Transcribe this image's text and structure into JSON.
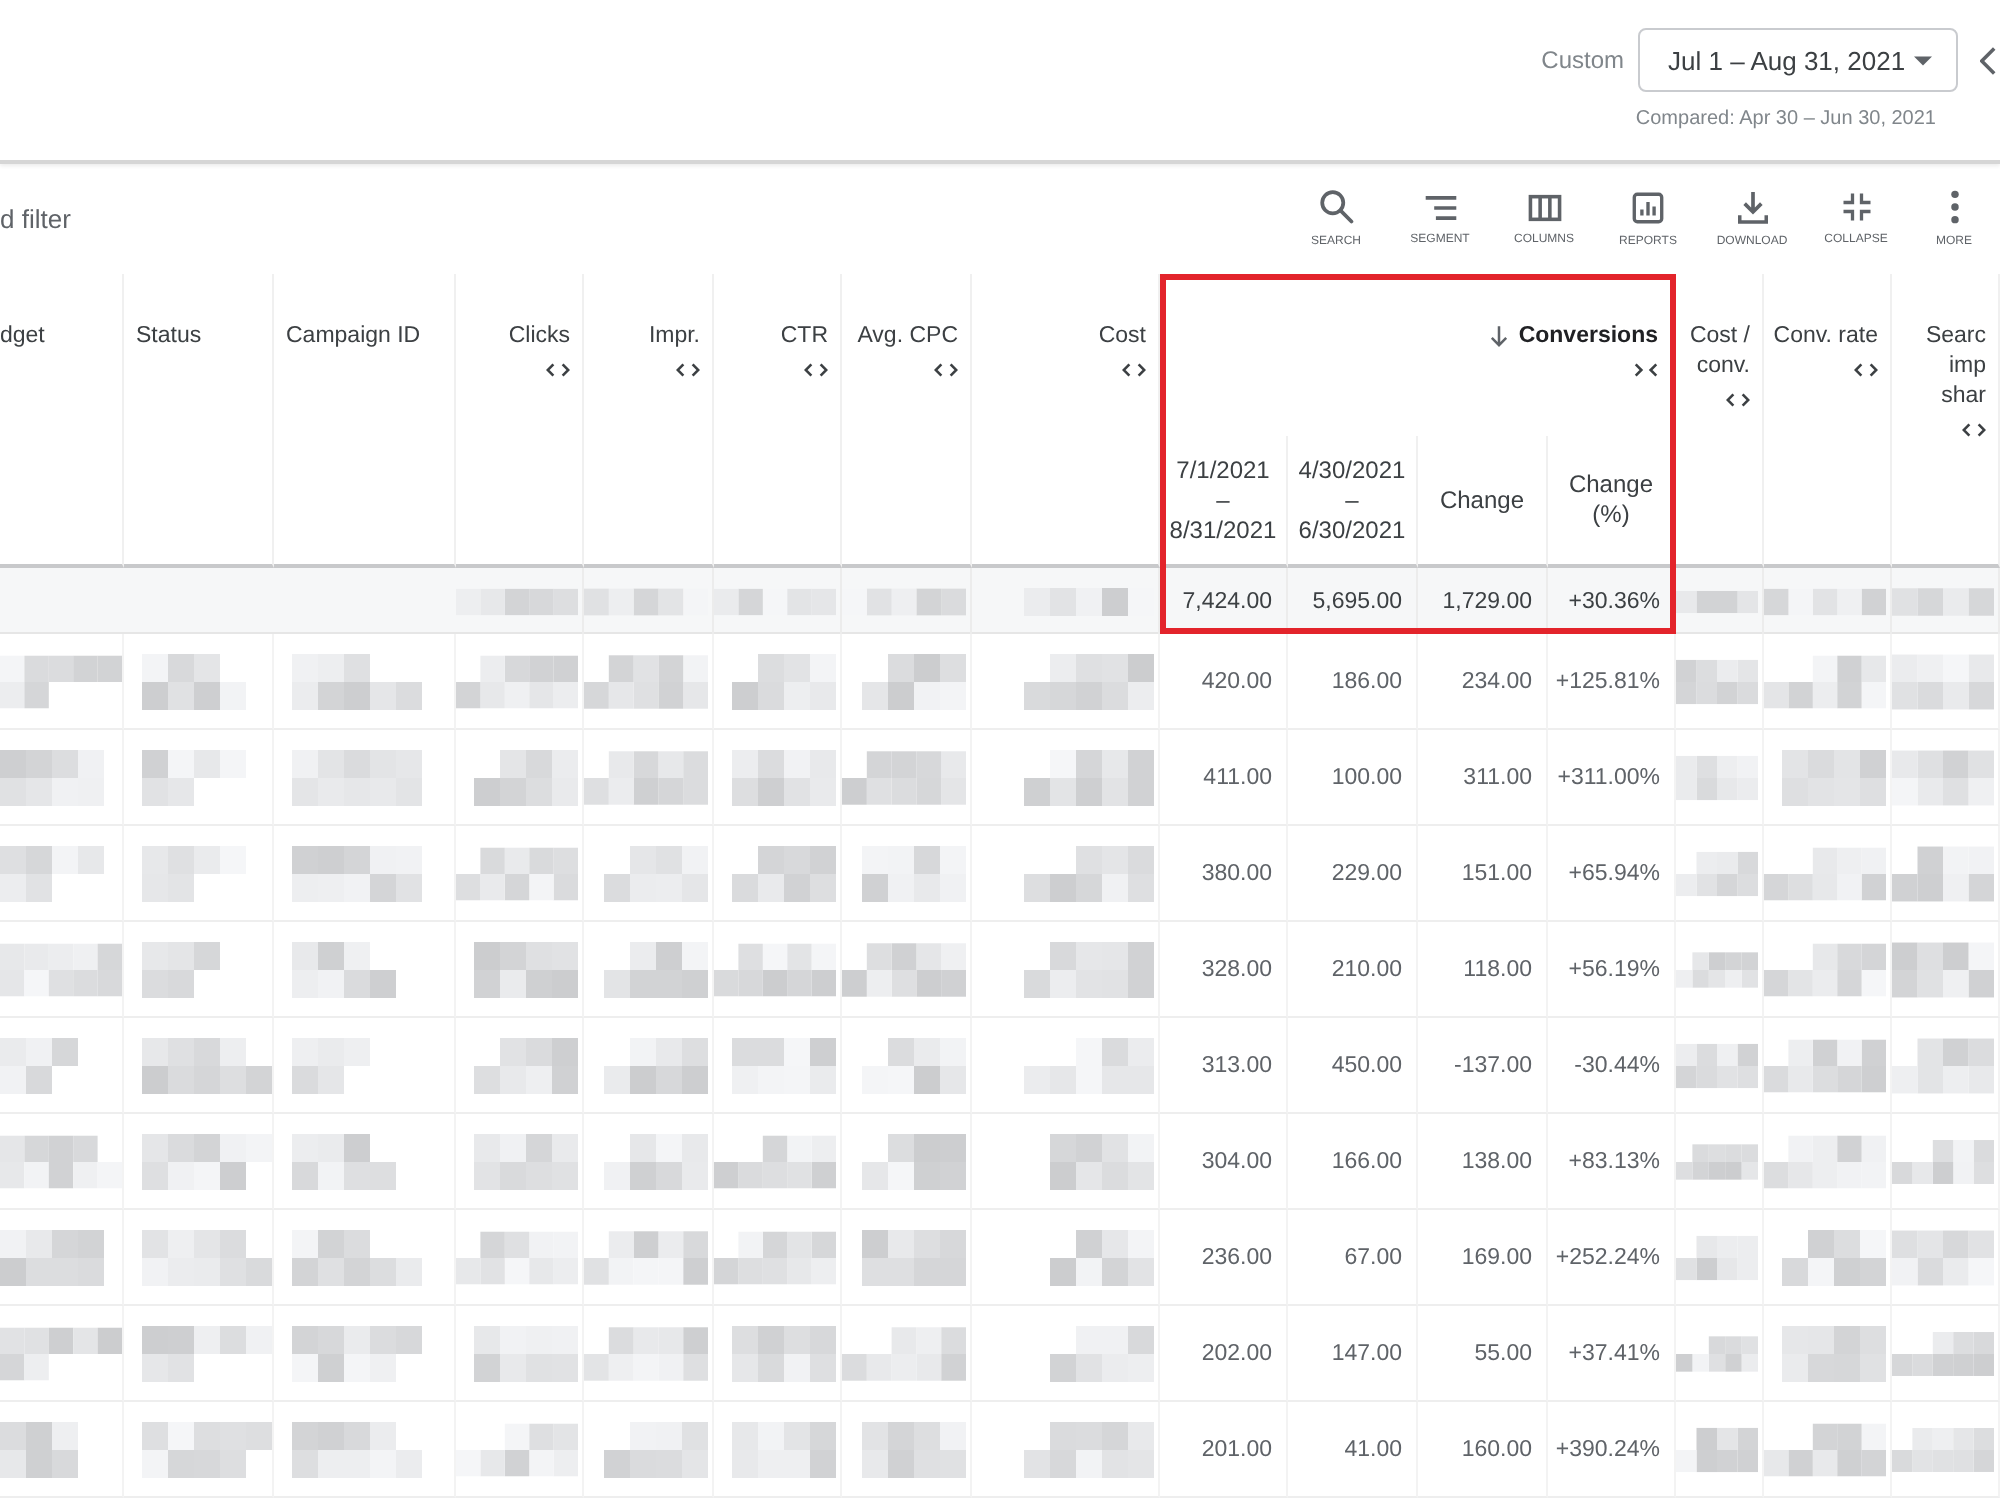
{
  "date_range": {
    "preset": "Custom",
    "value": "Jul 1 – Aug 31, 2021",
    "comparison": "Compared: Apr 30 – Jun 30, 2021"
  },
  "toolbar": {
    "filter": "d filter",
    "buttons": [
      "SEARCH",
      "SEGMENT",
      "COLUMNS",
      "REPORTS",
      "DOWNLOAD",
      "COLLAPSE",
      "MORE"
    ]
  },
  "table": {
    "columns": [
      {
        "label": "dget",
        "kind": "text",
        "redacted": true,
        "highlighted": false
      },
      {
        "label": "Status",
        "kind": "text",
        "redacted": true,
        "highlighted": false
      },
      {
        "label": "Campaign ID",
        "kind": "text",
        "redacted": true,
        "highlighted": false
      },
      {
        "label": "Clicks",
        "kind": "metric",
        "sorted": false,
        "expanded": false,
        "redacted": true,
        "highlighted": false
      },
      {
        "label": "Impr.",
        "kind": "metric",
        "sorted": false,
        "expanded": false,
        "redacted": true,
        "highlighted": false
      },
      {
        "label": "CTR",
        "kind": "metric",
        "sorted": false,
        "expanded": false,
        "redacted": true,
        "highlighted": false
      },
      {
        "label": "Avg. CPC",
        "kind": "metric",
        "sorted": false,
        "expanded": false,
        "redacted": true,
        "highlighted": false
      },
      {
        "label": "Cost",
        "kind": "metric",
        "sorted": false,
        "expanded": false,
        "redacted": true,
        "highlighted": false
      },
      {
        "label": "Conversions",
        "kind": "metric",
        "sorted": true,
        "expanded": true,
        "redacted": false,
        "highlighted": true,
        "subcolumns": [
          "7/1/2021 – 8/31/2021",
          "4/30/2021 – 6/30/2021",
          "Change",
          "Change (%)"
        ]
      },
      {
        "label": "Cost / conv.",
        "kind": "metric",
        "sorted": false,
        "expanded": false,
        "redacted": true,
        "highlighted": false
      },
      {
        "label": "Conv. rate",
        "kind": "metric",
        "sorted": false,
        "expanded": false,
        "redacted": true,
        "highlighted": false
      },
      {
        "label": "Searc imp shar",
        "kind": "metric",
        "sorted": false,
        "expanded": false,
        "redacted": true,
        "highlighted": false
      }
    ],
    "total_row": {
      "values": [
        "7,424.00",
        "5,695.00",
        "1,729.00",
        "+30.36%"
      ]
    },
    "rows": [
      {
        "values": [
          "420.00",
          "186.00",
          "234.00",
          "+125.81%"
        ]
      },
      {
        "values": [
          "411.00",
          "100.00",
          "311.00",
          "+311.00%"
        ]
      },
      {
        "values": [
          "380.00",
          "229.00",
          "151.00",
          "+65.94%"
        ]
      },
      {
        "values": [
          "328.00",
          "210.00",
          "118.00",
          "+56.19%"
        ]
      },
      {
        "values": [
          "313.00",
          "450.00",
          "-137.00",
          "-30.44%"
        ]
      },
      {
        "values": [
          "304.00",
          "166.00",
          "138.00",
          "+83.13%"
        ]
      },
      {
        "values": [
          "236.00",
          "67.00",
          "169.00",
          "+252.24%"
        ]
      },
      {
        "values": [
          "202.00",
          "147.00",
          "55.00",
          "+37.41%"
        ]
      },
      {
        "values": [
          "201.00",
          "41.00",
          "160.00",
          "+390.24%"
        ]
      }
    ]
  }
}
